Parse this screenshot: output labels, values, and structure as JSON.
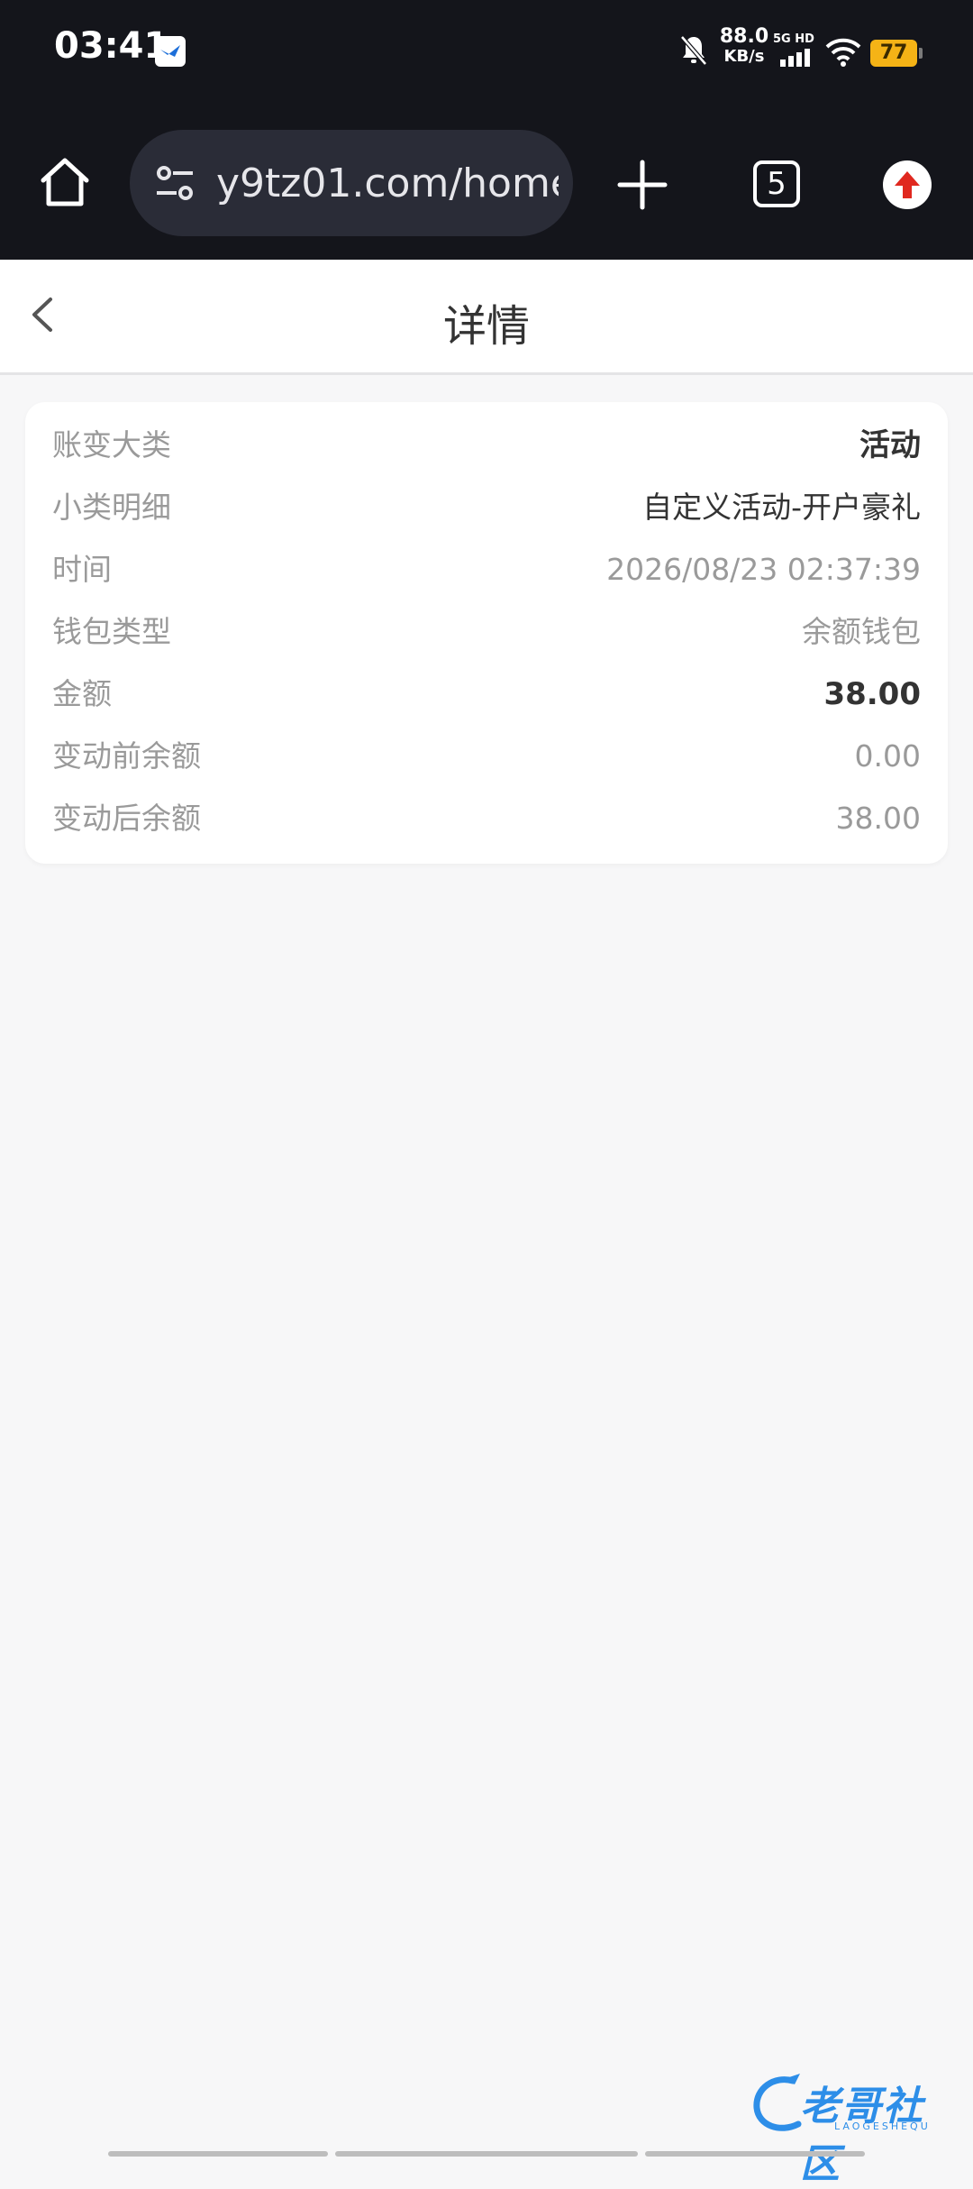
{
  "status_bar": {
    "time": "03:41",
    "net_speed_value": "88.0",
    "net_speed_unit": "KB/s",
    "network_label": "5G HD",
    "battery_level": "77"
  },
  "browser": {
    "url": "y9tz01.com/home",
    "tab_count": "5"
  },
  "header": {
    "title": "详情"
  },
  "details": {
    "rows": [
      {
        "label": "账变大类",
        "value": "活动"
      },
      {
        "label": "小类明细",
        "value": "自定义活动-开户豪礼"
      },
      {
        "label": "时间",
        "value": "2026/08/23 02:37:39"
      },
      {
        "label": "钱包类型",
        "value": "余额钱包"
      },
      {
        "label": "金额",
        "value": "38.00"
      },
      {
        "label": "变动前余额",
        "value": "0.00"
      },
      {
        "label": "变动后余额",
        "value": "38.00"
      }
    ]
  },
  "watermark": {
    "text": "老哥社区",
    "sub": "LAOGESHEQU"
  },
  "colors": {
    "top_bar": "#14151b",
    "page_bg": "#f7f7f8",
    "label_grey": "#9a9a9a",
    "value_dark": "#333333",
    "battery": "#f5b316",
    "watermark_blue": "#2d8ee8"
  }
}
